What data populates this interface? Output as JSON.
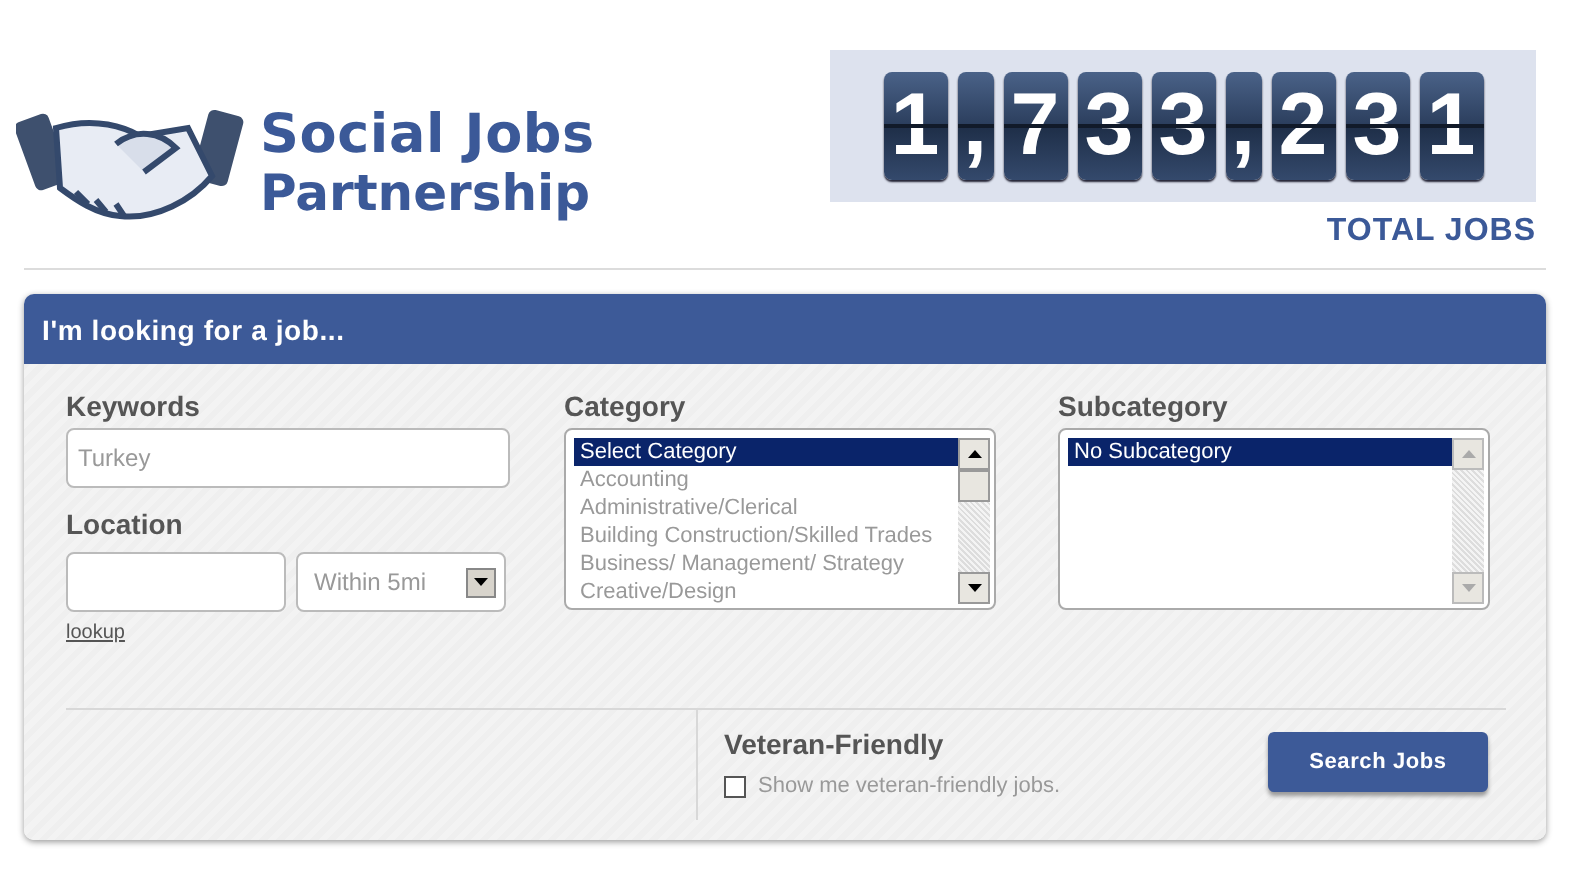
{
  "logo": {
    "name_line_1": "Social Jobs",
    "name_line_2": "Partnership"
  },
  "counter": {
    "tiles": [
      {
        "kind": "digit",
        "text": "1"
      },
      {
        "kind": "separator",
        "text": ","
      },
      {
        "kind": "digit",
        "text": "7"
      },
      {
        "kind": "digit",
        "text": "3"
      },
      {
        "kind": "digit",
        "text": "3"
      },
      {
        "kind": "separator",
        "text": ","
      },
      {
        "kind": "digit",
        "text": "2"
      },
      {
        "kind": "digit",
        "text": "3"
      },
      {
        "kind": "digit",
        "text": "1"
      }
    ],
    "caption": "TOTAL JOBS"
  },
  "search_panel": {
    "title": "I'm looking for a job...",
    "keywords": {
      "label": "Keywords",
      "placeholder": "Turkey"
    },
    "location": {
      "label": "Location",
      "distance": "Within 5mi",
      "lookup_link": "lookup"
    },
    "category": {
      "label": "Category",
      "options": [
        {
          "text": "Select Category",
          "selected": true
        },
        {
          "text": "Accounting",
          "selected": false
        },
        {
          "text": "Administrative/Clerical",
          "selected": false
        },
        {
          "text": "Building Construction/Skilled Trades",
          "selected": false
        },
        {
          "text": "Business/ Management/ Strategy",
          "selected": false
        },
        {
          "text": "Creative/Design",
          "selected": false
        }
      ],
      "scrollable": true
    },
    "subcategory": {
      "label": "Subcategory",
      "options": [
        {
          "text": "No Subcategory",
          "selected": true
        }
      ],
      "scrollable": false
    },
    "veteran": {
      "label": "Veteran-Friendly",
      "checkbox_label": "Show me veteran-friendly jobs.",
      "checked": false
    },
    "search_button": "Search Jobs"
  }
}
